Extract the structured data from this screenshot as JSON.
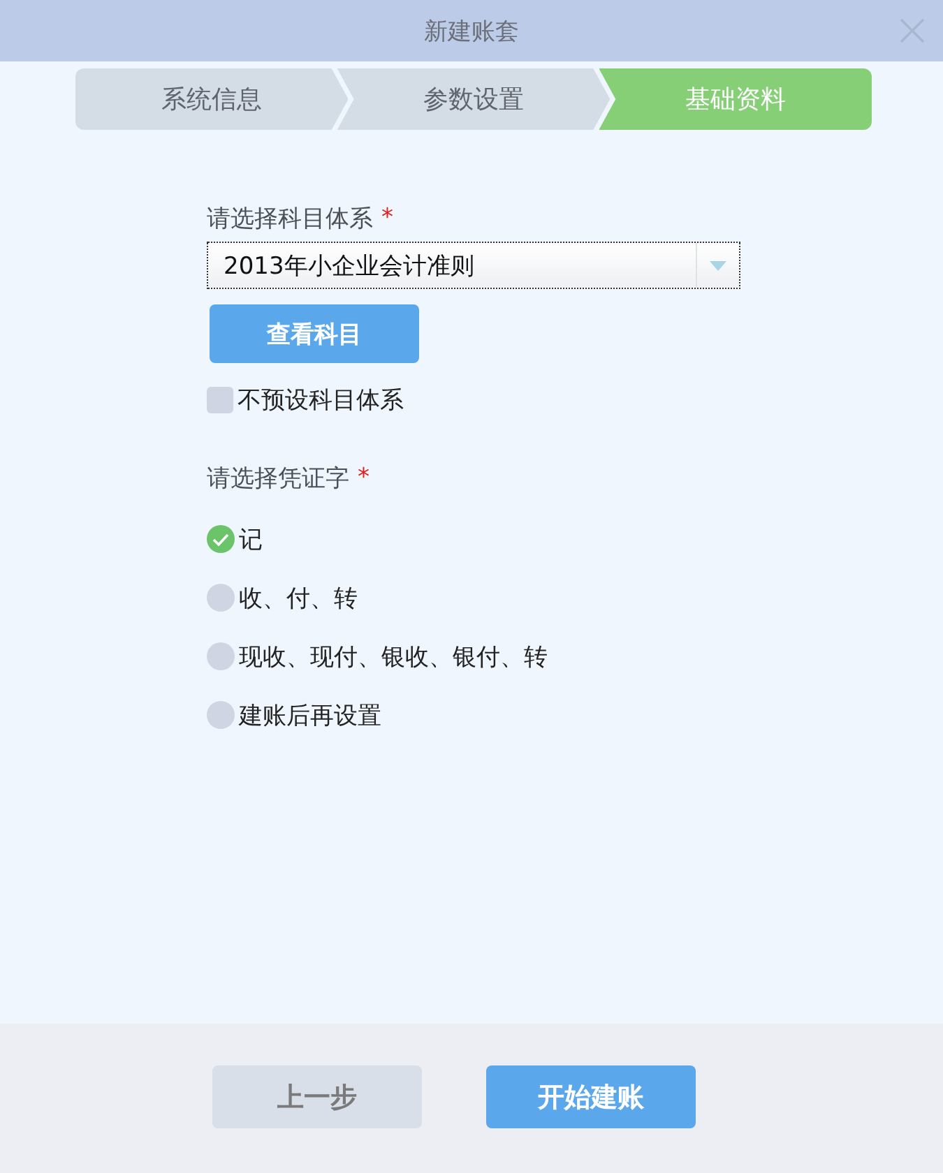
{
  "window": {
    "title": "新建账套"
  },
  "steps": [
    {
      "label": "系统信息",
      "selected": false
    },
    {
      "label": "参数设置",
      "selected": false
    },
    {
      "label": "基础资料",
      "selected": true
    }
  ],
  "account_system": {
    "label": "请选择科目体系",
    "required": "*",
    "value": "2013年小企业会计准则",
    "view_button": "查看科目"
  },
  "no_preset": {
    "label": "不预设科目体系",
    "checked": false
  },
  "voucher": {
    "label": "请选择凭证字",
    "required": "*",
    "options": [
      {
        "label": "记",
        "selected": true
      },
      {
        "label": "收、付、转",
        "selected": false
      },
      {
        "label": "现收、现付、银收、银付、转",
        "selected": false
      },
      {
        "label": "建账后再设置",
        "selected": false
      }
    ]
  },
  "buttons": {
    "back": "上一步",
    "start": "开始建账"
  }
}
